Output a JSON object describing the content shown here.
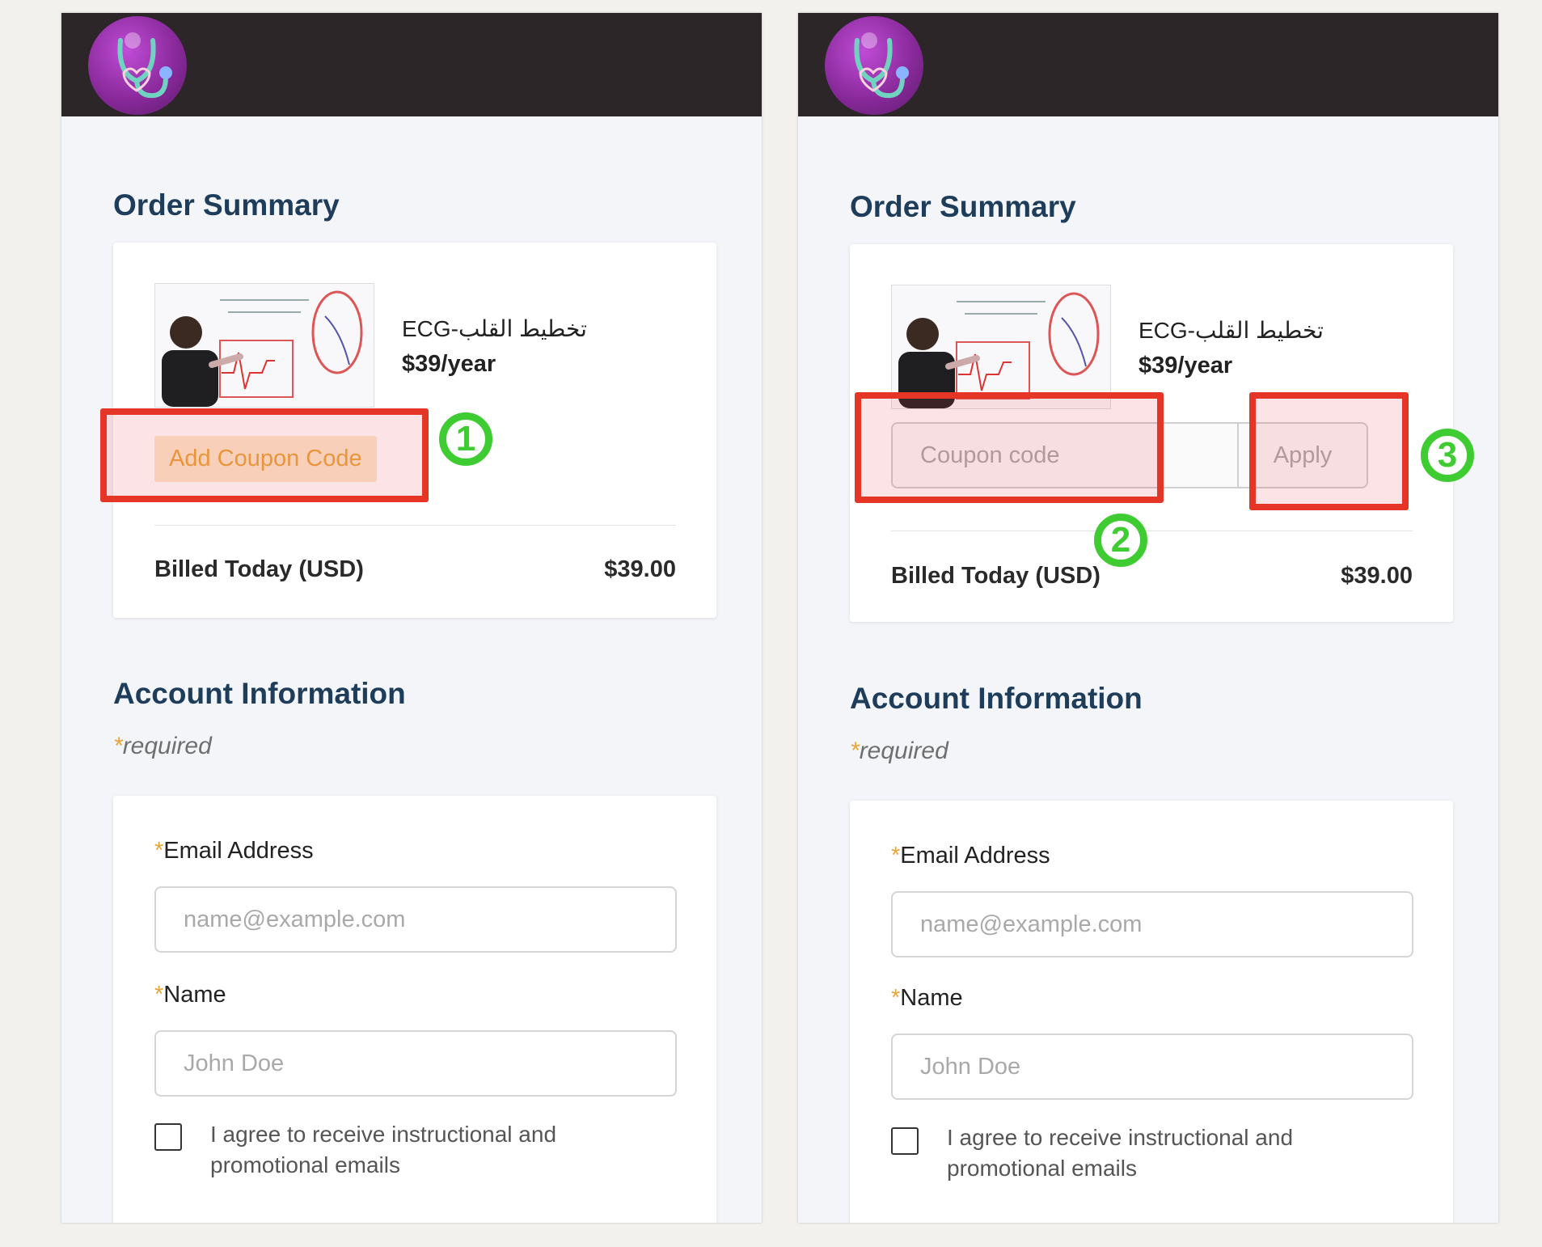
{
  "panels": [
    {
      "order_summary_title": "Order Summary",
      "product": {
        "name": "ECG-تخطيط القلب",
        "price": "$39/year"
      },
      "coupon_link": "Add Coupon Code",
      "billed_label": "Billed Today (USD)",
      "billed_value": "$39.00",
      "account_title": "Account Information",
      "required_star": "*",
      "required_text": "required",
      "email_label": "Email Address",
      "email_placeholder": "name@example.com",
      "name_label": "Name",
      "name_placeholder": "John Doe",
      "consent_text": "I agree to receive instructional and promotional emails"
    },
    {
      "order_summary_title": "Order Summary",
      "product": {
        "name": "ECG-تخطيط القلب",
        "price": "$39/year"
      },
      "coupon_placeholder": "Coupon code",
      "apply_label": "Apply",
      "billed_label": "Billed Today (USD)",
      "billed_value": "$39.00",
      "account_title": "Account Information",
      "required_star": "*",
      "required_text": "required",
      "email_label": "Email Address",
      "email_placeholder": "name@example.com",
      "name_label": "Name",
      "name_placeholder": "John Doe",
      "consent_text": "I agree to receive instructional and promotional emails"
    }
  ],
  "annotations": {
    "step1": "1",
    "step2": "2",
    "step3": "3",
    "highlight_color": "#e53526",
    "badge_color": "#3fcc32"
  },
  "colors": {
    "header_bg": "#2d2628",
    "heading": "#1e3d5a",
    "accent": "#e8a53b"
  }
}
